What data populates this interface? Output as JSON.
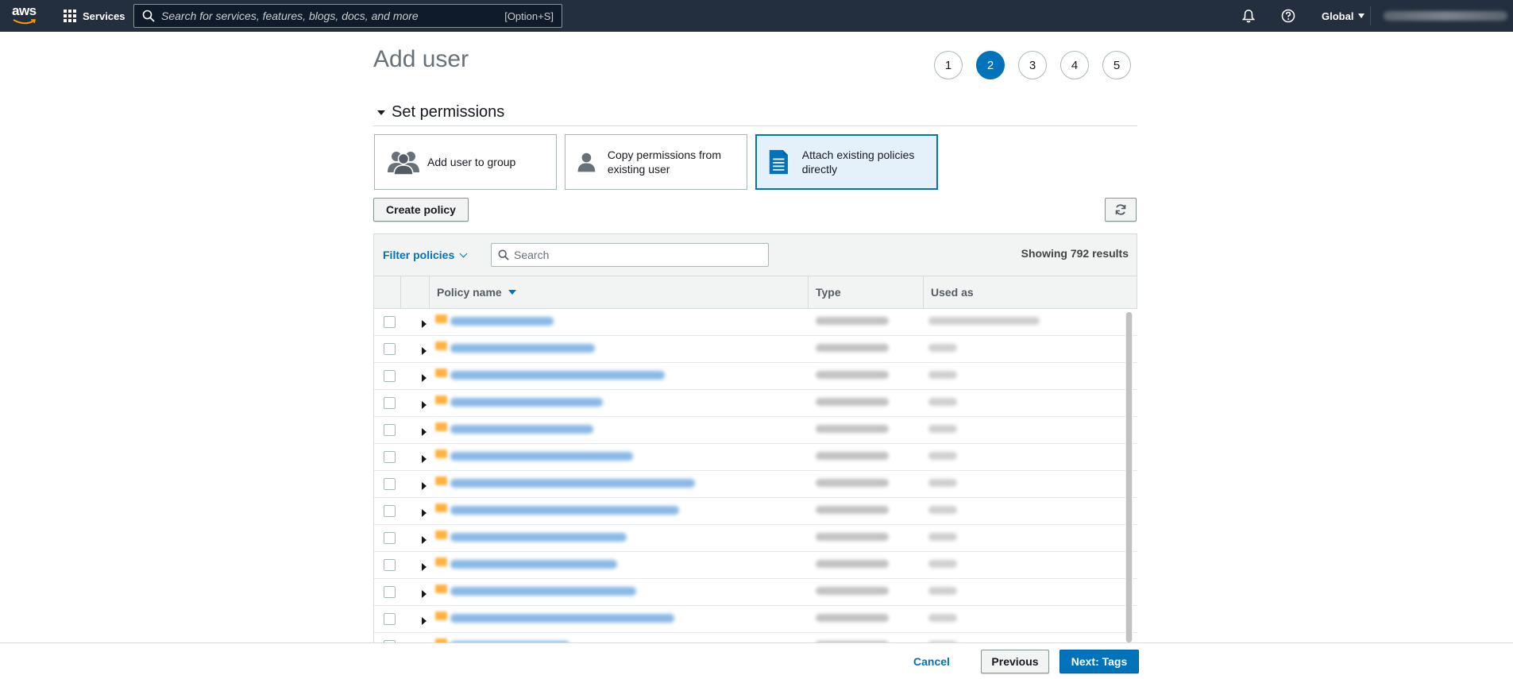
{
  "nav": {
    "services_label": "Services",
    "search_placeholder": "Search for services, features, blogs, docs, and more",
    "search_shortcut": "[Option+S]",
    "region": "Global"
  },
  "header": {
    "title": "Add user",
    "steps": [
      "1",
      "2",
      "3",
      "4",
      "5"
    ],
    "active_step": 2
  },
  "section": {
    "title": "Set permissions",
    "options": [
      {
        "label": "Add user to group",
        "icon": "group-icon"
      },
      {
        "label": "Copy permissions from existing user",
        "icon": "user-icon"
      },
      {
        "label": "Attach existing policies directly",
        "icon": "document-icon",
        "selected": true
      }
    ]
  },
  "actions": {
    "create_policy": "Create policy"
  },
  "table": {
    "filter_label": "Filter policies",
    "search_placeholder": "Search",
    "results_text": "Showing 792 results",
    "columns": [
      "Policy name",
      "Type",
      "Used as"
    ],
    "row_count": 12
  },
  "footer": {
    "cancel": "Cancel",
    "previous": "Previous",
    "next": "Next: Tags"
  },
  "colors": {
    "nav_bg": "#232f3e",
    "accent": "#0073bb",
    "selected_bg": "#e4f1fb"
  }
}
